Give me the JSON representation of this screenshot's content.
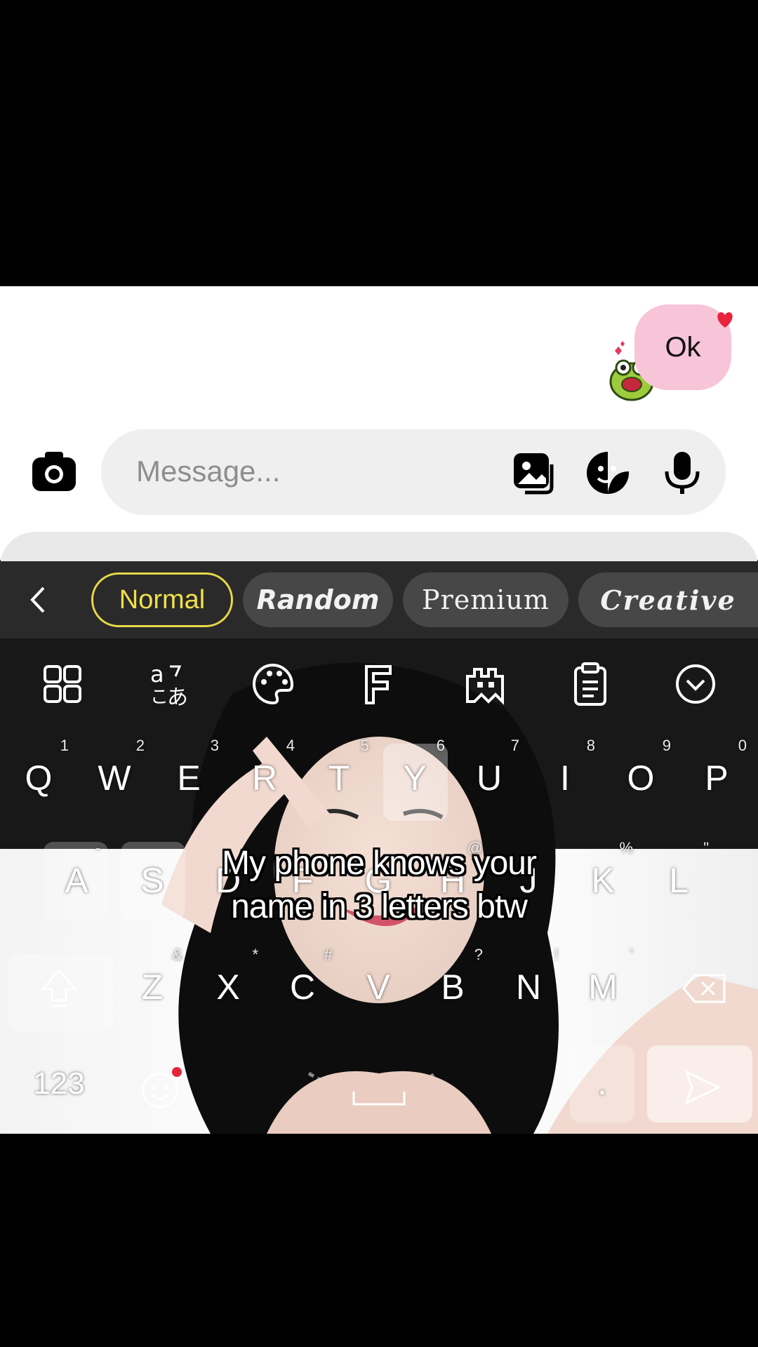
{
  "chat": {
    "message_bubble": "Ok",
    "bubble_color": "#f8c4d8",
    "heart_icon": "heart-icon",
    "sticker": "frog-sticker"
  },
  "composer": {
    "placeholder": "Message...",
    "icons": [
      "camera-icon",
      "gallery-icon",
      "sticker-icon",
      "microphone-icon"
    ]
  },
  "keyboard": {
    "font_styles": {
      "normal": "Normal",
      "random": "Random",
      "premium": "Premium",
      "creative": "Creative",
      "active": "Normal"
    },
    "toolbar_icons": [
      "apps-grid-icon",
      "translate-icon",
      "palette-icon",
      "font-icon",
      "game-icon",
      "clipboard-icon",
      "collapse-icon"
    ],
    "row1": [
      {
        "ch": "Q",
        "hint": "1"
      },
      {
        "ch": "W",
        "hint": "2"
      },
      {
        "ch": "E",
        "hint": "3"
      },
      {
        "ch": "R",
        "hint": "4"
      },
      {
        "ch": "T",
        "hint": "5"
      },
      {
        "ch": "Y",
        "hint": "6"
      },
      {
        "ch": "U",
        "hint": "7"
      },
      {
        "ch": "I",
        "hint": "8"
      },
      {
        "ch": "O",
        "hint": "9"
      },
      {
        "ch": "P",
        "hint": "0"
      }
    ],
    "row2": [
      {
        "ch": "A",
        "hint": "-"
      },
      {
        "ch": "S",
        "hint": ""
      },
      {
        "ch": "D",
        "hint": ""
      },
      {
        "ch": "F",
        "hint": ""
      },
      {
        "ch": "G",
        "hint": ""
      },
      {
        "ch": "H",
        "hint": "@"
      },
      {
        "ch": "J",
        "hint": ""
      },
      {
        "ch": "K",
        "hint": "%"
      },
      {
        "ch": "L",
        "hint": "\""
      }
    ],
    "row3": [
      {
        "ch": "Z",
        "hint": "&"
      },
      {
        "ch": "X",
        "hint": "*"
      },
      {
        "ch": "C",
        "hint": "#"
      },
      {
        "ch": "V",
        "hint": ""
      },
      {
        "ch": "B",
        "hint": "?"
      },
      {
        "ch": "N",
        "hint": "!"
      },
      {
        "ch": "M",
        "hint": "'"
      }
    ],
    "numbers_key": "123",
    "period_key": "."
  },
  "caption": {
    "line1": "My phone knows your",
    "line2": "name in 3 letters btw"
  }
}
